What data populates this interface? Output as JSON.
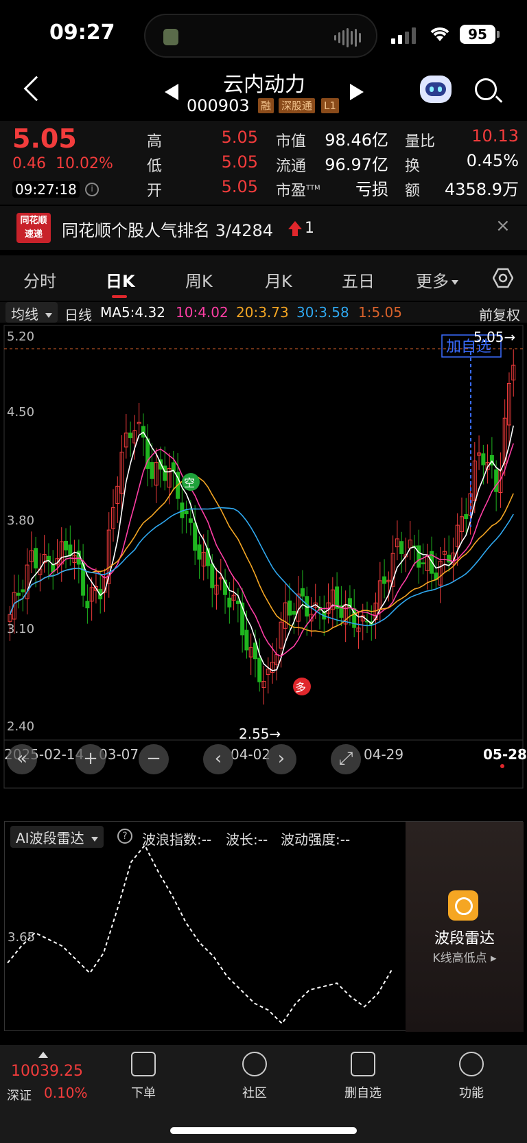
{
  "status": {
    "time": "09:27",
    "battery": "95"
  },
  "nav": {
    "name": "云内动力",
    "code": "000903",
    "tags": [
      "融",
      "深股通",
      "L1"
    ]
  },
  "quote": {
    "price": "5.05",
    "change": "0.46",
    "change_pct": "10.02%",
    "time": "09:27:18",
    "high_label": "高",
    "high": "5.05",
    "low_label": "低",
    "low": "5.05",
    "open_label": "开",
    "open": "5.05",
    "mktcap_label": "市值",
    "mktcap": "98.46亿",
    "float_label": "流通",
    "float": "96.97亿",
    "pe_label": "市盈",
    "pe_sup": "TTM",
    "pe": "亏损",
    "vr_label": "量比",
    "vr": "10.13",
    "turn_label": "换",
    "turn": "0.45%",
    "amt_label": "额",
    "amt": "4358.9万"
  },
  "banner": {
    "logo_top": "同花顺",
    "logo_bottom": "速递",
    "text": "同花顺个股人气排名 3/4284",
    "count": "1",
    "close": "×"
  },
  "tabs": [
    "分时",
    "日K",
    "周K",
    "月K",
    "五日",
    "更多"
  ],
  "ma": {
    "select": "均线",
    "period": "日线",
    "ma5": "MA5:4.32",
    "ma10": "10:4.02",
    "ma20": "20:3.73",
    "ma30": "30:3.58",
    "ma1": "1:5.05",
    "adjust": "前复权"
  },
  "chart": {
    "y_ticks": [
      "5.20",
      "4.50",
      "3.80",
      "3.10",
      "2.40"
    ],
    "x_ticks": [
      "2025-02-14",
      "03-07",
      "04-02",
      "04-29",
      "05-28"
    ],
    "high_label": "5.05→",
    "low_label": "2.55→",
    "add_watch": "加自选",
    "sell_marker": "空",
    "buy_marker": "多",
    "colors": {
      "up": "#f23c3c",
      "down": "#1fb51f",
      "ma5": "#ffffff",
      "ma10": "#ff3ea5",
      "ma20": "#f5a623",
      "ma30": "#2fa8f0"
    }
  },
  "controls": [
    "«",
    "+",
    "−",
    "‹",
    "›",
    "⤢"
  ],
  "radar": {
    "select": "AI波段雷达",
    "help": "?",
    "wave_index": "波浪指数:--",
    "wave_len": "波长:--",
    "wave_strength": "波动强度:--",
    "y_tick": "3.65",
    "panel_title": "波段雷达",
    "panel_sub": "K线高低点 ▸"
  },
  "bottom": {
    "index_value": "10039.25",
    "index_name": "深证",
    "index_pct": "0.10%",
    "items": [
      "下单",
      "社区",
      "删自选",
      "功能"
    ]
  }
}
